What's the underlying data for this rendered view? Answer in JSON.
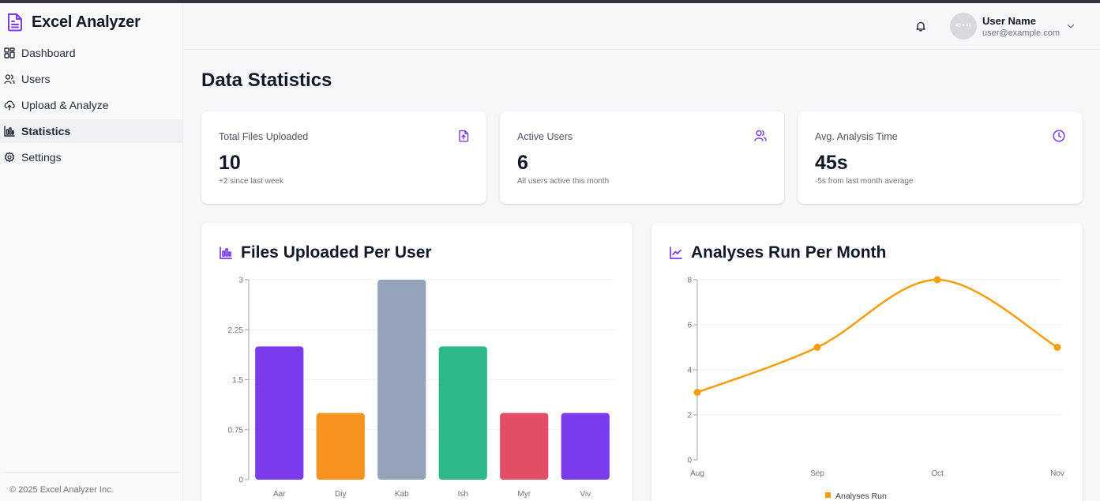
{
  "app": {
    "title": "Excel Analyzer",
    "footer": "© 2025 Excel Analyzer Inc."
  },
  "sidebar": {
    "items": [
      {
        "label": "Dashboard",
        "icon": "dashboard-grid-icon",
        "active": false
      },
      {
        "label": "Users",
        "icon": "users-icon",
        "active": false
      },
      {
        "label": "Upload & Analyze",
        "icon": "cloud-upload-icon",
        "active": false
      },
      {
        "label": "Statistics",
        "icon": "bar-chart-icon",
        "active": true
      },
      {
        "label": "Settings",
        "icon": "gear-icon",
        "active": false
      }
    ]
  },
  "header": {
    "avatar_text": "40 × 40",
    "user_name": "User Name",
    "user_email": "user@example.com"
  },
  "page": {
    "title": "Data Statistics"
  },
  "stats": [
    {
      "label": "Total Files Uploaded",
      "value": "10",
      "sub": "+2 since last week",
      "icon": "file-icon"
    },
    {
      "label": "Active Users",
      "value": "6",
      "sub": "All users active this month",
      "icon": "users-icon"
    },
    {
      "label": "Avg. Analysis Time",
      "value": "45s",
      "sub": "-5s from last month average",
      "icon": "clock-icon"
    }
  ],
  "colors": {
    "accent": "#7c3aed",
    "line": "#f59e0b"
  },
  "chart_data": [
    {
      "type": "bar",
      "title": "Files Uploaded Per User",
      "categories": [
        "Aar",
        "Diy",
        "Kab",
        "Ish",
        "Myr",
        "Viv"
      ],
      "values": [
        2,
        1,
        3,
        2,
        1,
        1
      ],
      "colors": [
        "#7c3aed",
        "#f7931e",
        "#94a3b8",
        "#2eb888",
        "#e44d66",
        "#7c3aed"
      ],
      "ylim": [
        0,
        3
      ],
      "yticks": [
        "0",
        "0.75",
        "1.5",
        "2.25",
        "3"
      ],
      "grid": true
    },
    {
      "type": "line",
      "title": "Analyses Run Per Month",
      "categories": [
        "Aug",
        "Sep",
        "Oct",
        "Nov"
      ],
      "series": [
        {
          "name": "Analyses Run",
          "values": [
            3,
            5,
            8,
            5
          ],
          "color": "#f59e0b"
        }
      ],
      "ylim": [
        0,
        8
      ],
      "yticks": [
        "0",
        "2",
        "4",
        "6",
        "8"
      ],
      "grid": true,
      "legend": "bottom"
    }
  ]
}
